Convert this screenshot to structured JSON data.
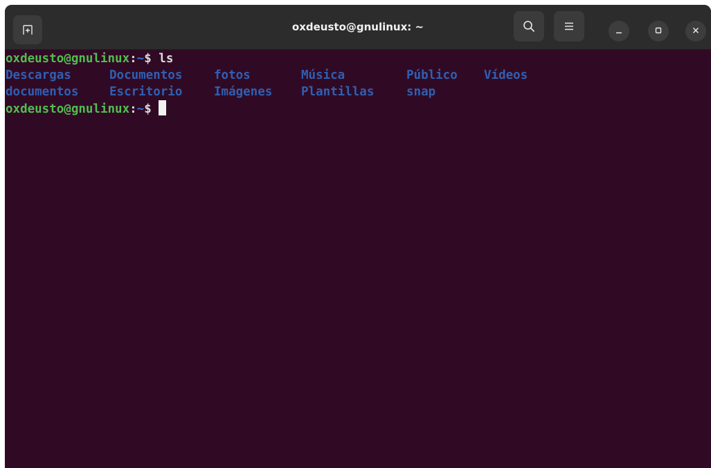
{
  "window": {
    "title": "oxdeusto@gnulinux: ~"
  },
  "icons": {
    "new_tab": "new-tab-icon",
    "search": "search-icon",
    "menu": "hamburger-menu-icon",
    "minimize": "minimize-icon",
    "maximize": "maximize-icon",
    "close": "close-icon"
  },
  "colors": {
    "terminal_bg": "#300a24",
    "titlebar_bg": "#2c2c2c",
    "prompt_user": "#4fbf4f",
    "prompt_path": "#3b6fcf",
    "directory": "#2f5fb3"
  },
  "terminal": {
    "prompt_user": "oxdeusto@gnulinux",
    "prompt_colon": ":",
    "prompt_path": "~",
    "prompt_symbol": "$ ",
    "command": "ls",
    "listing_row1": [
      "Descargas",
      "Documentos",
      "fotos",
      "Música",
      "Público",
      "Vídeos"
    ],
    "listing_row2": [
      "documentos",
      "Escritorio",
      "Imágenes",
      "Plantillas",
      "snap"
    ]
  }
}
